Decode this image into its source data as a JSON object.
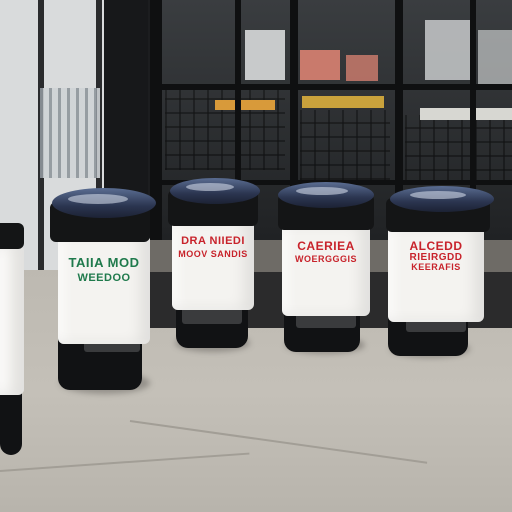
{
  "scene": {
    "bins": [
      {
        "id": "bin-partial-left",
        "label_lines": [
          "",
          ""
        ],
        "label_color": "#3a3a3a"
      },
      {
        "id": "bin-green",
        "label_lines": [
          "TAIIA MOD",
          "WEEDOO"
        ],
        "label_color": "#1f7a4c"
      },
      {
        "id": "bin-red-1",
        "label_lines": [
          "DRA NIIEDI",
          "MOOV SANDIS"
        ],
        "label_color": "#c8232b"
      },
      {
        "id": "bin-red-2",
        "label_lines": [
          "CAERIEA",
          "WOERGGGIS"
        ],
        "label_color": "#c8232b"
      },
      {
        "id": "bin-red-3",
        "label_lines": [
          "ALCEDD",
          "RIEIRGDD",
          "KEERAFIS"
        ],
        "label_color": "#c8232b"
      }
    ],
    "colors": {
      "bin_body": "#f4f3f0",
      "bin_base": "#111214",
      "lid": "#2b3550",
      "sidewalk": "#bdb9b1",
      "storefront": "#1c1d1f"
    }
  }
}
